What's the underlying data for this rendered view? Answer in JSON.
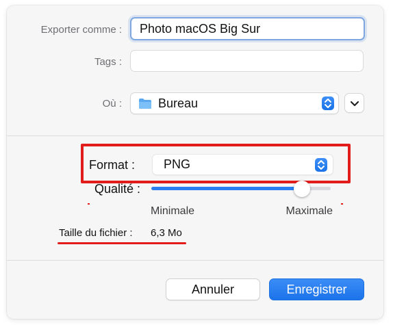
{
  "form": {
    "export_as_label": "Exporter comme :",
    "export_as_value": "Photo macOS Big Sur",
    "tags_label": "Tags :",
    "tags_value": "",
    "where_label": "Où :",
    "where_value": "Bureau"
  },
  "format": {
    "label": "Format :",
    "value": "PNG"
  },
  "quality": {
    "label": "Qualité :",
    "min_label": "Minimale",
    "max_label": "Maximale",
    "level": 0.84
  },
  "file_size": {
    "label": "Taille du fichier :",
    "value": "6,3 Mo"
  },
  "buttons": {
    "cancel": "Annuler",
    "save": "Enregistrer"
  },
  "colors": {
    "accent": "#1d74ea",
    "highlight": "#e21b1b"
  },
  "icons": {
    "folder": "folder-icon",
    "stepper": "up-down-chevron-icon",
    "expand": "chevron-down-icon"
  }
}
